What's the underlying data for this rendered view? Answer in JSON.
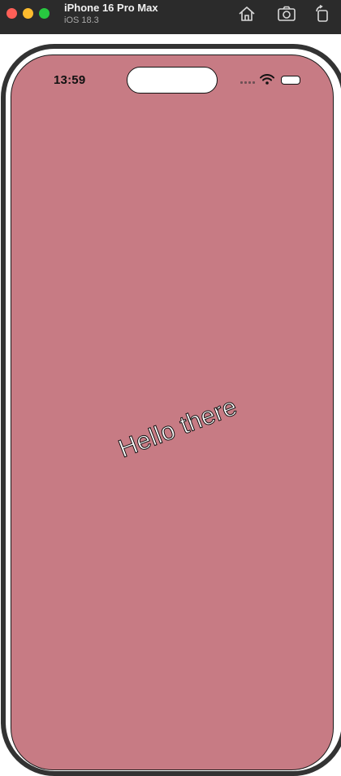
{
  "window": {
    "title": "iPhone 16 Pro Max",
    "subtitle": "iOS 18.3",
    "buttons": {
      "home": "home-icon",
      "screenshot": "camera-icon",
      "rotate": "rotate-icon"
    }
  },
  "status_bar": {
    "time": "13:59"
  },
  "screen": {
    "background": "#c77b84",
    "greeting": "Hello there"
  }
}
